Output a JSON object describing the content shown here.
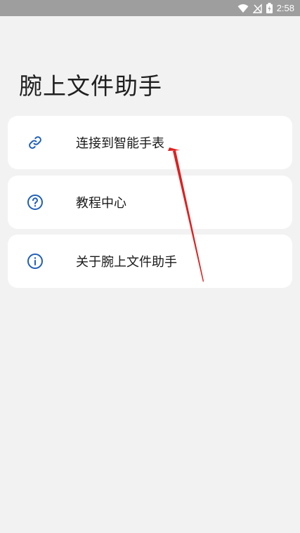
{
  "status_bar": {
    "time": "2:58",
    "icons": [
      "wifi-icon",
      "no-signal-icon",
      "battery-charging-icon"
    ]
  },
  "page": {
    "title": "腕上文件助手"
  },
  "menu": {
    "items": [
      {
        "label": "连接到智能手表",
        "icon": "link-icon"
      },
      {
        "label": "教程中心",
        "icon": "help-circle-icon"
      },
      {
        "label": "关于腕上文件助手",
        "icon": "info-circle-icon"
      }
    ]
  },
  "colors": {
    "accent_icon": "#1f5fb8",
    "annotation_arrow": "#e02020",
    "background": "#f2f2f2",
    "card": "#ffffff",
    "status_bar": "#9e9e9e"
  }
}
